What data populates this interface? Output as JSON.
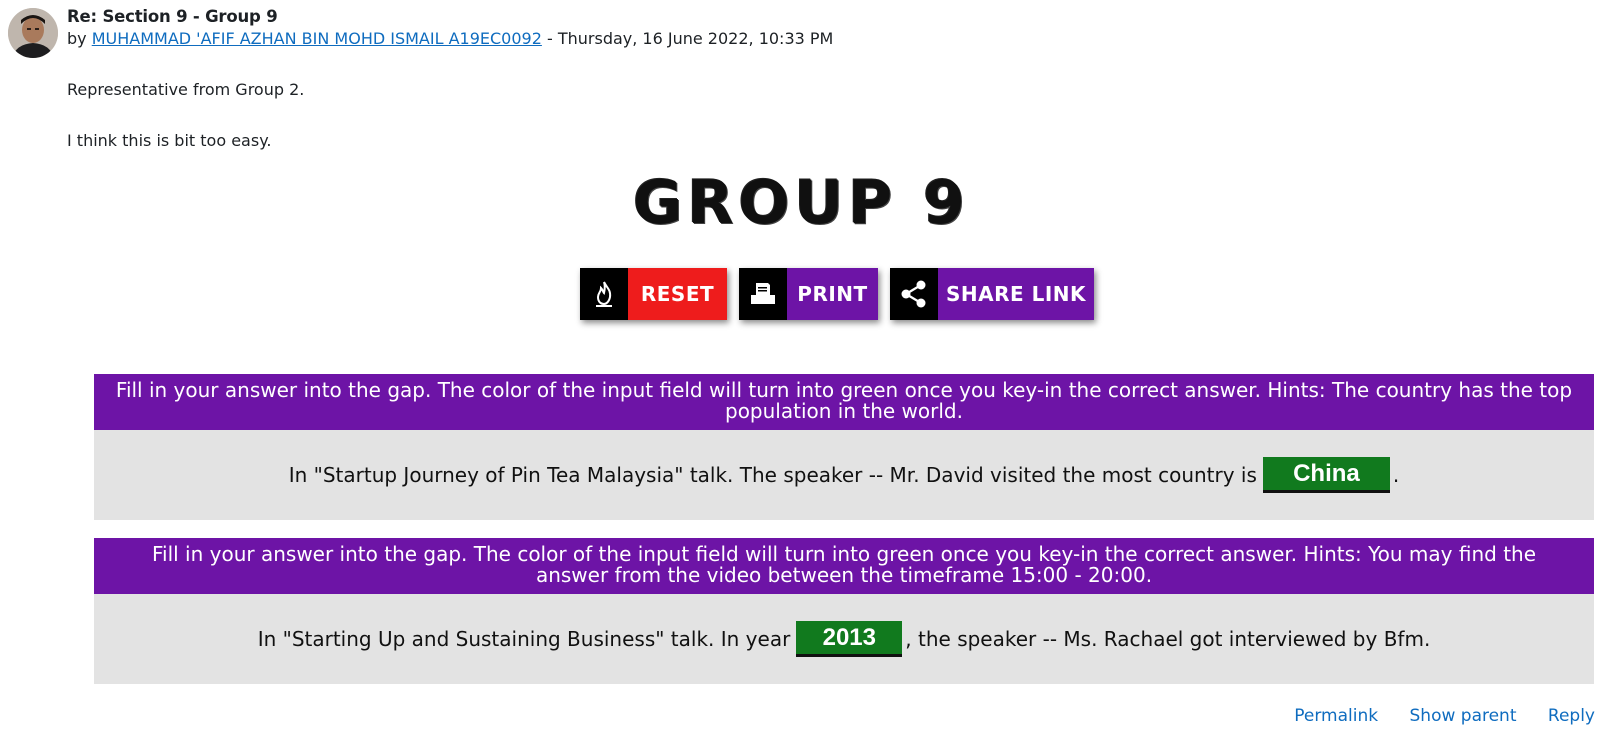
{
  "post": {
    "subject": "Re: Section 9 - Group 9",
    "by_prefix": "by",
    "author": "MUHAMMAD 'AFIF AZHAN BIN MOHD ISMAIL A19EC0092",
    "date_sep": "- Thursday, 16 June 2022, 10:33 PM",
    "line1": "Representative from Group 2.",
    "line2": "I think this is bit too easy."
  },
  "activity": {
    "title": "GROUP 9",
    "buttons": [
      {
        "label": "RESET",
        "icon": "fire-icon",
        "color": "#ee1c1c"
      },
      {
        "label": "PRINT",
        "icon": "printer-icon",
        "color": "#6d14a6"
      },
      {
        "label": "SHARE LINK",
        "icon": "share-icon",
        "color": "#6d14a6"
      }
    ],
    "questions": [
      {
        "instruction": "Fill in your answer into the gap. The color of the input field will turn into green once you key-in the correct answer. Hints: The country has the top population in the world.",
        "before": "In \"Startup Journey of Pin Tea Malaysia\" talk. The speaker -- Mr. David visited the most country is",
        "answer": "China",
        "after": "."
      },
      {
        "instruction": "Fill in your answer into the gap. The color of the input field will turn into green once you key-in the correct answer. Hints: You may find the answer from the video between the timeframe 15:00 - 20:00.",
        "before": "In \"Starting Up and Sustaining Business\" talk. In year",
        "answer": "2013",
        "after": ", the speaker -- Ms. Rachael got interviewed by Bfm."
      }
    ]
  },
  "footer": {
    "permalink": "Permalink",
    "show_parent": "Show parent",
    "reply": "Reply"
  },
  "colors": {
    "link": "#0f6cbf",
    "purple": "#6d14a6",
    "red": "#ee1c1c",
    "correct_green": "#117a1e",
    "panel_grey": "#e3e3e3"
  }
}
